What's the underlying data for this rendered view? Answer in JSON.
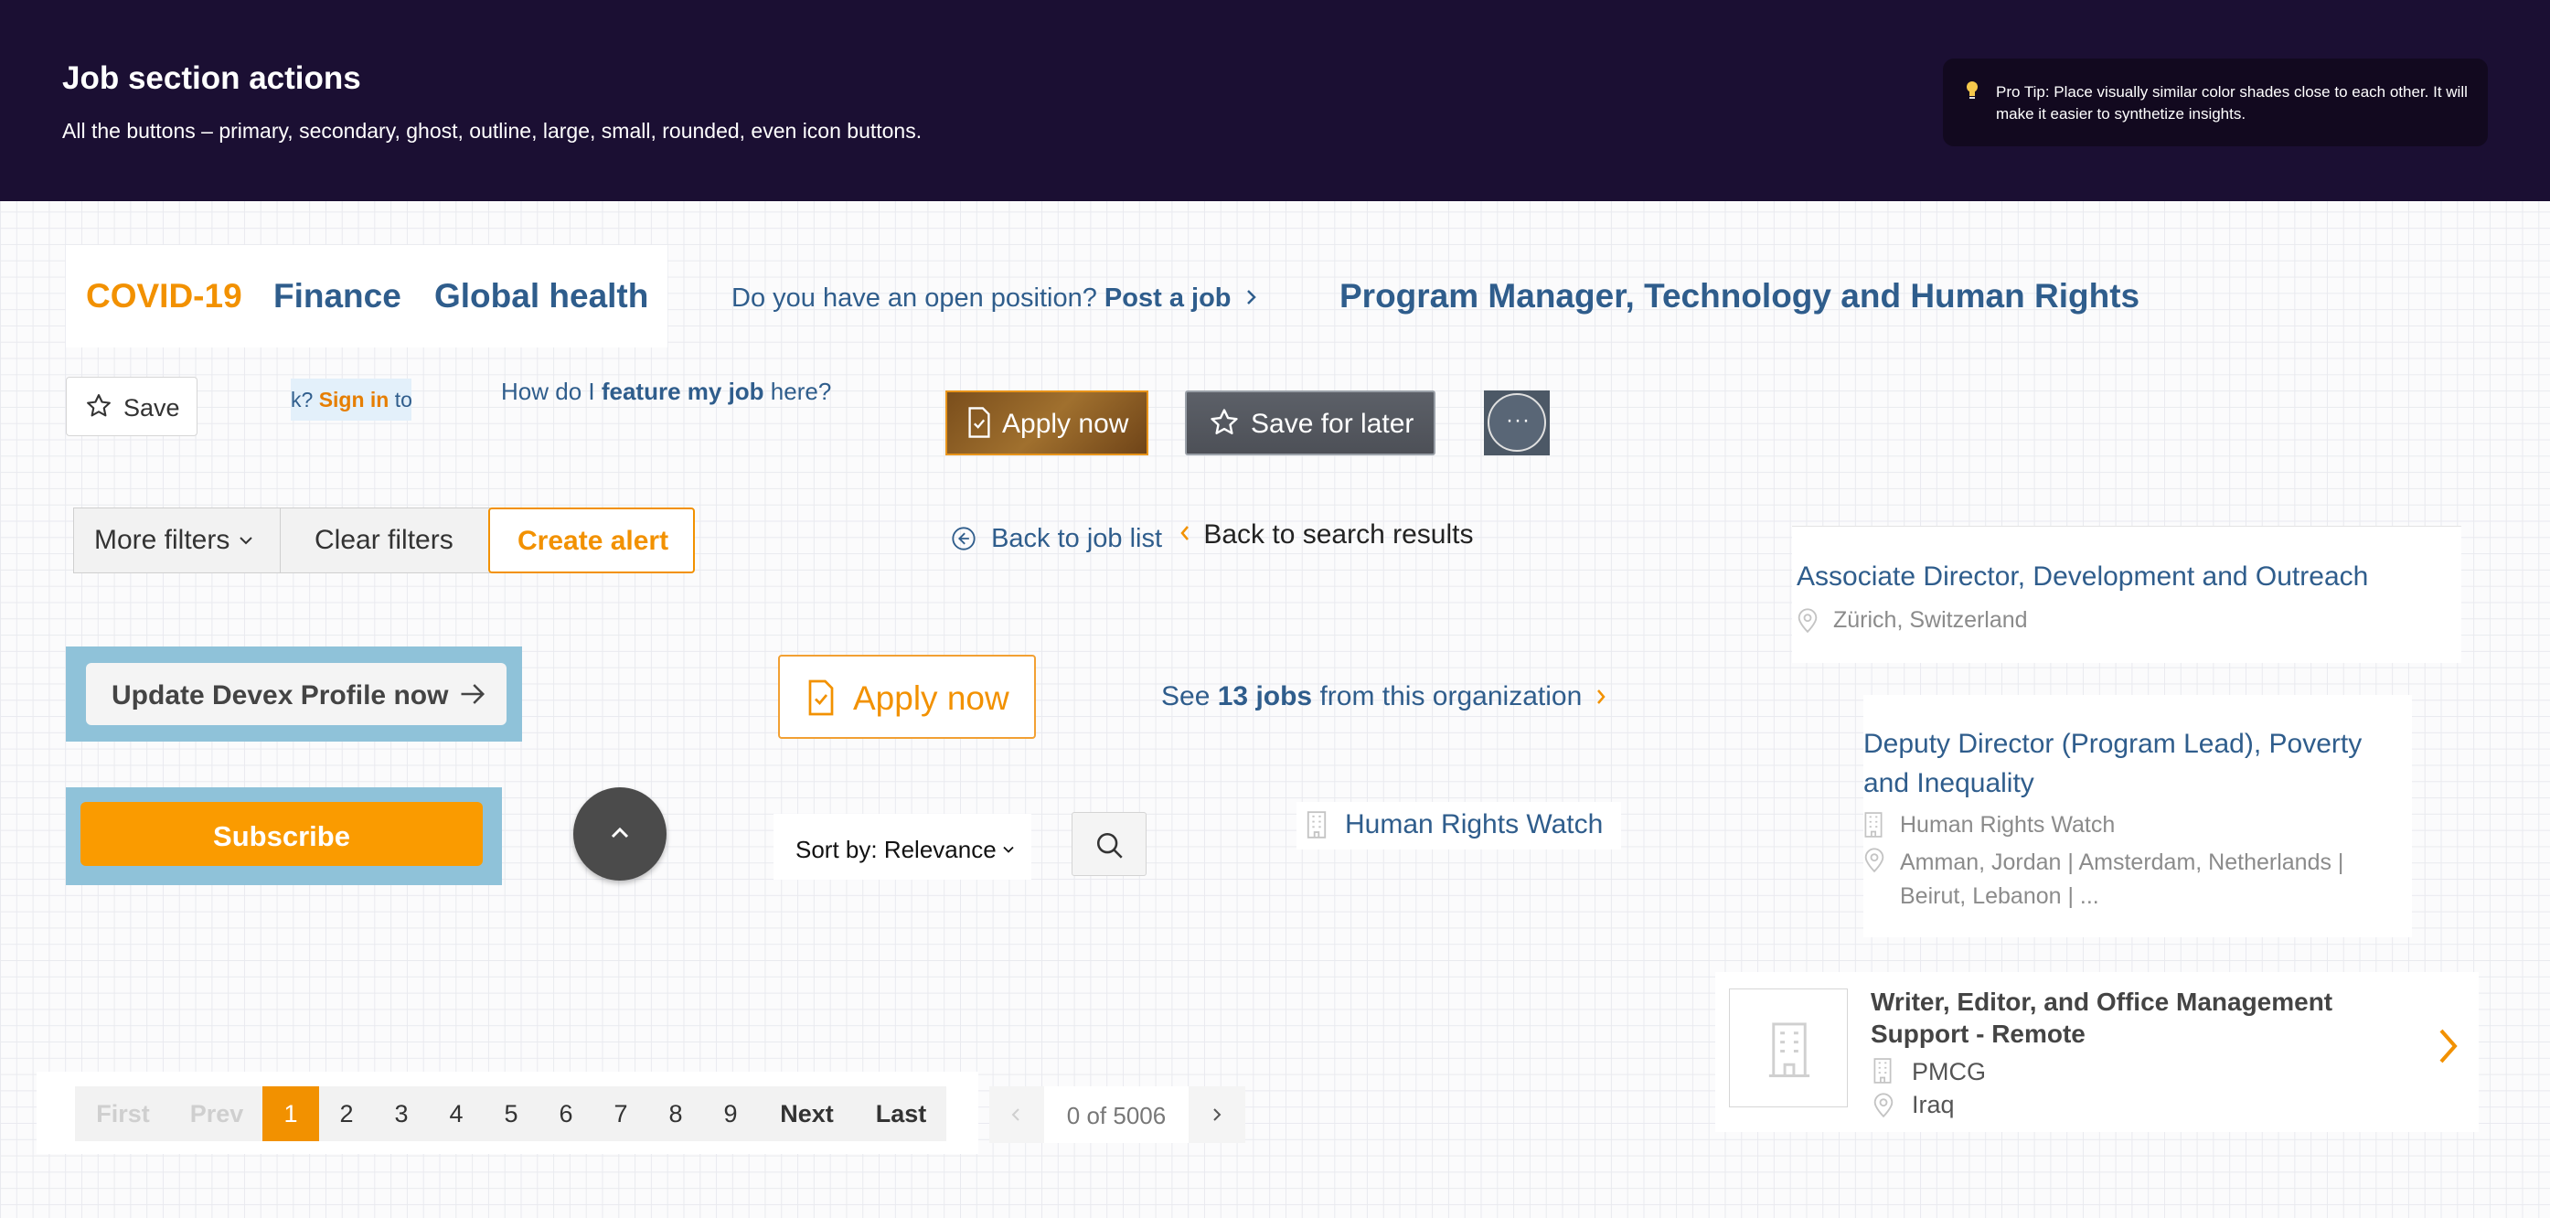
{
  "header": {
    "title": "Job section actions",
    "subtitle": "All the buttons – primary, secondary, ghost, outline, large, small, rounded, even icon buttons.",
    "tip": "Pro Tip: Place visually similar color shades close to each other. It will make it easier to synthetize insights."
  },
  "tags": [
    "COVID-19",
    "Finance",
    "Global health"
  ],
  "tag_colors": [
    "#f29100",
    "#2f5d8c",
    "#2f5d8c"
  ],
  "post_job": {
    "question": "Do you have an open position?",
    "link": "Post a job"
  },
  "job_title": "Program Manager, Technology and Human Rights",
  "save_label": "Save",
  "signin": {
    "pre": "k?",
    "link": "Sign in",
    "post": "to"
  },
  "feature": {
    "pre": "How do I",
    "bold": "feature my job",
    "post": "here?"
  },
  "apply_now": "Apply now",
  "save_later": "Save for later",
  "more_label": "···",
  "filters": {
    "more": "More filters",
    "clear": "Clear filters",
    "alert": "Create alert"
  },
  "back_job": "Back to job list",
  "back_search": "Back to search results",
  "cards": [
    {
      "title": "Associate Director, Development and Outreach",
      "location": "Zürich, Switzerland"
    },
    {
      "title": "Deputy Director (Program Lead), Poverty and Inequality",
      "org": "Human Rights Watch",
      "location": "Amman, Jordan | Amsterdam, Netherlands | Beirut, Lebanon | ..."
    },
    {
      "title": "Writer, Editor, and Office Management Support - Remote",
      "org": "PMCG",
      "location": "Iraq"
    }
  ],
  "update_profile": "Update Devex Profile now",
  "see_jobs": {
    "pre": "See",
    "bold": "13 jobs",
    "post": "from this organization"
  },
  "subscribe": "Subscribe",
  "sort_label": "Sort by: Relevance",
  "org_link": "Human Rights Watch",
  "pagination": [
    "First",
    "Prev",
    "1",
    "2",
    "3",
    "4",
    "5",
    "6",
    "7",
    "8",
    "9",
    "Next",
    "Last"
  ],
  "active_page": "1",
  "result_count": "0 of 5006",
  "colors": {
    "brand_orange": "#f29100",
    "link_blue": "#2f5d8c",
    "header_bg": "#1b0f33",
    "highlight_bg": "#8fc2d9"
  }
}
